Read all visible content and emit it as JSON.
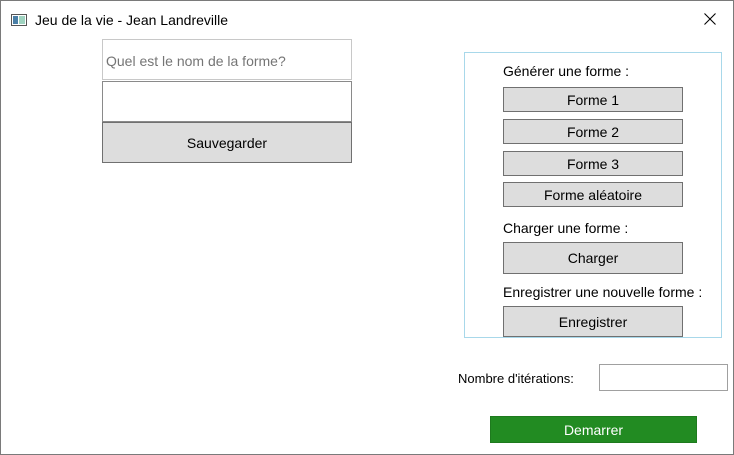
{
  "window": {
    "title": "Jeu de la vie - Jean Landreville"
  },
  "shape_name": {
    "placeholder": "Quel est le nom de la forme?",
    "value": "",
    "save_label": "Sauvegarder"
  },
  "panel": {
    "generate_label": "Générer une forme :",
    "buttons": [
      "Forme 1",
      "Forme 2",
      "Forme 3",
      "Forme aléatoire"
    ],
    "load_label": "Charger une forme :",
    "load_button": "Charger",
    "save_new_label": "Enregistrer une nouvelle forme :",
    "save_new_button": "Enregistrer"
  },
  "iterations": {
    "label": "Nombre d'itérations:",
    "value": ""
  },
  "start_button": "Demarrer",
  "colors": {
    "start_button": "#228b22",
    "panel_border": "#a8d8ea"
  }
}
